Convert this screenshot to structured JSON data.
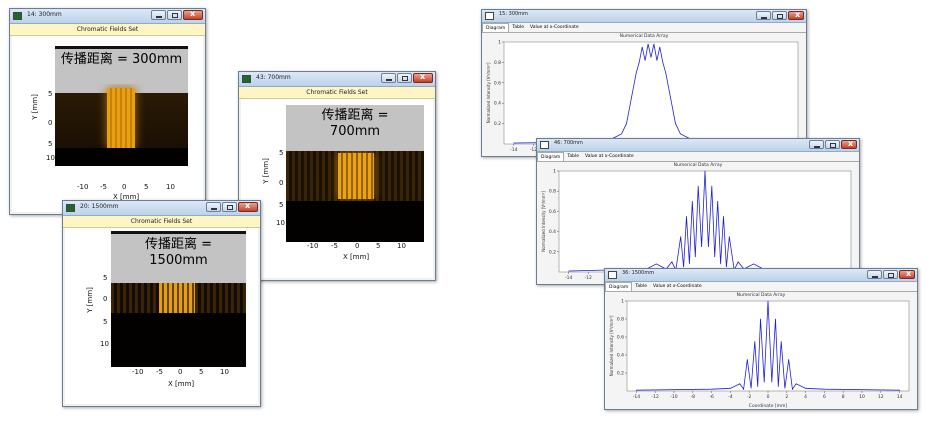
{
  "win_300": {
    "title": "14: 300mm",
    "subtitle": "Chromatic Fields Set",
    "overlay": "传播距离 = 300mm",
    "xlabel": "X [mm]",
    "ylabel": "Y [mm]",
    "xticks": [
      "-10",
      "-5",
      "0",
      "5",
      "10"
    ],
    "yticks": [
      "5",
      "0",
      "5",
      "10"
    ]
  },
  "win_700": {
    "title": "43: 700mm",
    "subtitle": "Chromatic Fields Set",
    "overlay_1": "传播距离 =",
    "overlay_2": "700mm",
    "xlabel": "X [mm]",
    "ylabel": "Y [mm]",
    "xticks": [
      "-10",
      "-5",
      "0",
      "5",
      "10"
    ],
    "yticks": [
      "5",
      "0",
      "5",
      "10"
    ]
  },
  "win_1500": {
    "title": "20: 1500mm",
    "subtitle": "Chromatic Fields Set",
    "overlay_1": "传播距离 =",
    "overlay_2": "1500mm",
    "xlabel": "X [mm]",
    "ylabel": "Y [mm]",
    "xticks": [
      "-10",
      "-5",
      "0",
      "5",
      "10"
    ],
    "yticks": [
      "5",
      "0",
      "5",
      "10"
    ]
  },
  "nd_1": {
    "title": "15: 300mm",
    "tabs": [
      "Diagram",
      "Table",
      "Value at x-Coordinate"
    ],
    "heading": "Numerical Data Array",
    "ylabel": "Normalized Intensity [V²/mm²]",
    "xlabel": ""
  },
  "nd_2": {
    "title": "46: 700mm",
    "tabs": [
      "Diagram",
      "Table",
      "Value at x-Coordinate"
    ],
    "heading": "Numerical Data Array",
    "ylabel": "Normalized Intensity [V²/mm²]",
    "xlabel": ""
  },
  "nd_3": {
    "title": "36: 1500mm",
    "tabs": [
      "Diagram",
      "Table",
      "Value at x-Coordinate"
    ],
    "heading": "Numerical Data Array",
    "ylabel": "Normalized Intensity [V²/mm²]",
    "xlabel": "Coordinate [mm]"
  },
  "chart_data": [
    {
      "type": "line",
      "title": "Numerical Data Array",
      "ylabel": "Normalized Intensity [V²/mm²]",
      "xlim": [
        -15,
        15
      ],
      "ylim": [
        0,
        1
      ],
      "xticks": [
        -14,
        -12,
        -10,
        -8,
        -6,
        -4,
        -2,
        0,
        2,
        4,
        6,
        8,
        10,
        12,
        14
      ],
      "yticks": [
        0.2,
        0.4,
        0.6,
        0.8,
        1
      ],
      "x": [
        -14,
        -6,
        -4,
        -3,
        -2.5,
        -2,
        -1.5,
        -1.2,
        -0.9,
        -0.6,
        -0.3,
        0,
        0.3,
        0.6,
        0.9,
        1.2,
        1.5,
        2,
        2.5,
        3,
        4,
        6,
        14
      ],
      "y": [
        0.01,
        0.02,
        0.05,
        0.1,
        0.2,
        0.45,
        0.7,
        0.8,
        0.95,
        0.82,
        0.98,
        0.85,
        0.98,
        0.82,
        0.95,
        0.8,
        0.7,
        0.45,
        0.2,
        0.1,
        0.05,
        0.02,
        0.01
      ]
    },
    {
      "type": "line",
      "title": "Numerical Data Array",
      "ylabel": "Normalized Intensity [V²/mm²]",
      "xlim": [
        -15,
        15
      ],
      "ylim": [
        0,
        1
      ],
      "xticks": [
        -14,
        -12,
        -10,
        -8,
        -6,
        -4,
        -2,
        0,
        2,
        4,
        6,
        8,
        10,
        12,
        14
      ],
      "yticks": [
        0.2,
        0.4,
        0.6,
        0.8,
        1
      ],
      "x": [
        -14,
        -6,
        -5,
        -4,
        -3.4,
        -3,
        -2.5,
        -2.2,
        -1.9,
        -1.6,
        -1.3,
        -1,
        -0.7,
        -0.35,
        0,
        0.35,
        0.7,
        1,
        1.3,
        1.6,
        1.9,
        2.2,
        2.5,
        3,
        3.4,
        4,
        5,
        6,
        14
      ],
      "y": [
        0.01,
        0.03,
        0.08,
        0.03,
        0.1,
        0.02,
        0.35,
        0.05,
        0.55,
        0.08,
        0.7,
        0.15,
        0.85,
        0.25,
        1.0,
        0.25,
        0.85,
        0.15,
        0.7,
        0.08,
        0.55,
        0.05,
        0.35,
        0.02,
        0.1,
        0.03,
        0.08,
        0.03,
        0.01
      ]
    },
    {
      "type": "line",
      "title": "Numerical Data Array",
      "xlabel": "Coordinate [mm]",
      "ylabel": "Normalized Intensity [V²/mm²]",
      "xlim": [
        -15,
        15
      ],
      "ylim": [
        0,
        1
      ],
      "xticks": [
        -14,
        -12,
        -10,
        -8,
        -6,
        -4,
        -2,
        0,
        2,
        4,
        6,
        8,
        10,
        12,
        14
      ],
      "yticks": [
        0.2,
        0.4,
        0.6,
        0.8,
        1
      ],
      "x": [
        -14,
        -6,
        -4,
        -3,
        -2.6,
        -2.2,
        -1.8,
        -1.4,
        -1.1,
        -0.8,
        -0.4,
        0,
        0.4,
        0.8,
        1.1,
        1.4,
        1.8,
        2.2,
        2.6,
        3,
        4,
        6,
        14
      ],
      "y": [
        0.01,
        0.02,
        0.03,
        0.08,
        0.02,
        0.35,
        0.03,
        0.55,
        0.05,
        0.8,
        0.1,
        1.0,
        0.1,
        0.8,
        0.05,
        0.55,
        0.03,
        0.35,
        0.02,
        0.08,
        0.03,
        0.02,
        0.01
      ]
    }
  ]
}
